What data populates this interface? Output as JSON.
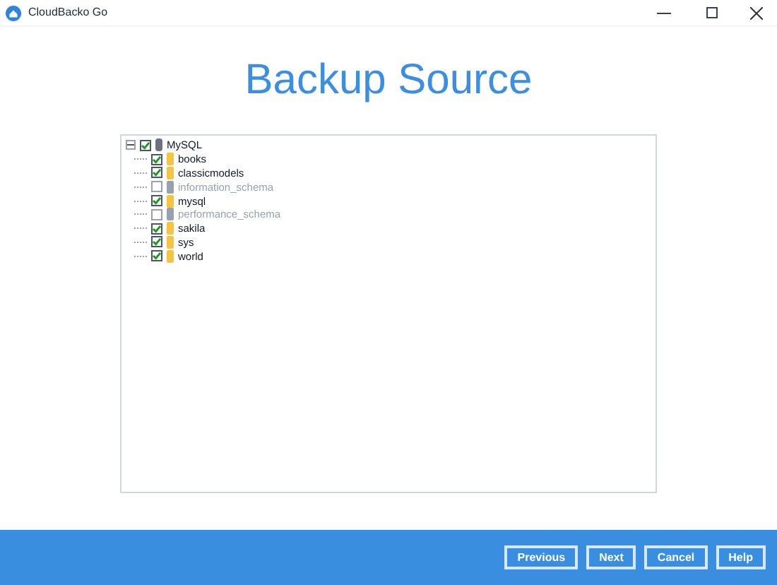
{
  "window": {
    "title": "CloudBacko Go"
  },
  "heading": "Backup Source",
  "tree": [
    {
      "label": "MySQL",
      "kind": "server",
      "checked": true,
      "expanded": true,
      "disabled": false,
      "children": [
        {
          "label": "books",
          "kind": "database",
          "checked": true,
          "disabled": false
        },
        {
          "label": "classicmodels",
          "kind": "database",
          "checked": true,
          "disabled": false
        },
        {
          "label": "information_schema",
          "kind": "system",
          "checked": false,
          "disabled": true
        },
        {
          "label": "mysql",
          "kind": "database",
          "checked": true,
          "disabled": false
        },
        {
          "label": "performance_schema",
          "kind": "system",
          "checked": false,
          "disabled": true
        },
        {
          "label": "sakila",
          "kind": "database",
          "checked": true,
          "disabled": false
        },
        {
          "label": "sys",
          "kind": "database",
          "checked": true,
          "disabled": false
        },
        {
          "label": "world",
          "kind": "database",
          "checked": true,
          "disabled": false
        }
      ]
    }
  ],
  "buttons": [
    "Previous",
    "Next",
    "Cancel",
    "Help"
  ]
}
